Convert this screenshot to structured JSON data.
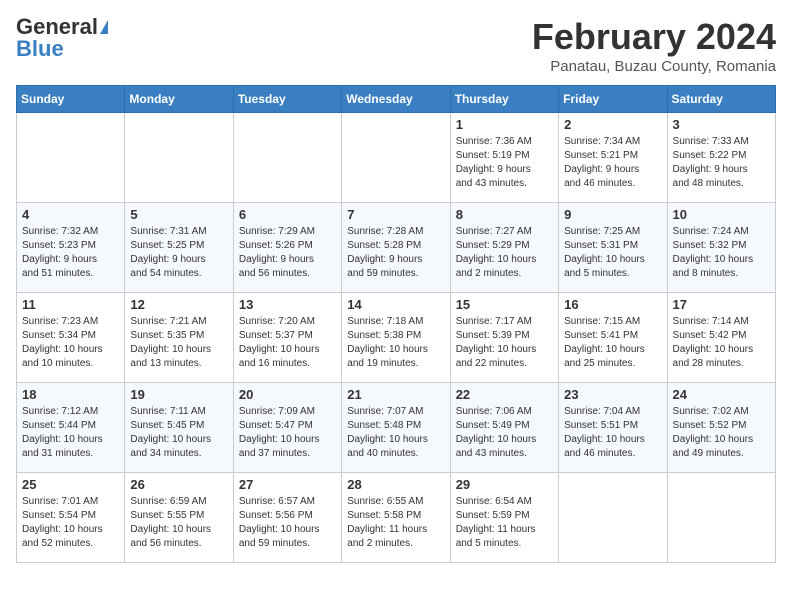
{
  "header": {
    "logo_general": "General",
    "logo_blue": "Blue",
    "month_title": "February 2024",
    "location": "Panatau, Buzau County, Romania"
  },
  "calendar": {
    "days_of_week": [
      "Sunday",
      "Monday",
      "Tuesday",
      "Wednesday",
      "Thursday",
      "Friday",
      "Saturday"
    ],
    "weeks": [
      [
        {
          "day": "",
          "info": ""
        },
        {
          "day": "",
          "info": ""
        },
        {
          "day": "",
          "info": ""
        },
        {
          "day": "",
          "info": ""
        },
        {
          "day": "1",
          "info": "Sunrise: 7:36 AM\nSunset: 5:19 PM\nDaylight: 9 hours\nand 43 minutes."
        },
        {
          "day": "2",
          "info": "Sunrise: 7:34 AM\nSunset: 5:21 PM\nDaylight: 9 hours\nand 46 minutes."
        },
        {
          "day": "3",
          "info": "Sunrise: 7:33 AM\nSunset: 5:22 PM\nDaylight: 9 hours\nand 48 minutes."
        }
      ],
      [
        {
          "day": "4",
          "info": "Sunrise: 7:32 AM\nSunset: 5:23 PM\nDaylight: 9 hours\nand 51 minutes."
        },
        {
          "day": "5",
          "info": "Sunrise: 7:31 AM\nSunset: 5:25 PM\nDaylight: 9 hours\nand 54 minutes."
        },
        {
          "day": "6",
          "info": "Sunrise: 7:29 AM\nSunset: 5:26 PM\nDaylight: 9 hours\nand 56 minutes."
        },
        {
          "day": "7",
          "info": "Sunrise: 7:28 AM\nSunset: 5:28 PM\nDaylight: 9 hours\nand 59 minutes."
        },
        {
          "day": "8",
          "info": "Sunrise: 7:27 AM\nSunset: 5:29 PM\nDaylight: 10 hours\nand 2 minutes."
        },
        {
          "day": "9",
          "info": "Sunrise: 7:25 AM\nSunset: 5:31 PM\nDaylight: 10 hours\nand 5 minutes."
        },
        {
          "day": "10",
          "info": "Sunrise: 7:24 AM\nSunset: 5:32 PM\nDaylight: 10 hours\nand 8 minutes."
        }
      ],
      [
        {
          "day": "11",
          "info": "Sunrise: 7:23 AM\nSunset: 5:34 PM\nDaylight: 10 hours\nand 10 minutes."
        },
        {
          "day": "12",
          "info": "Sunrise: 7:21 AM\nSunset: 5:35 PM\nDaylight: 10 hours\nand 13 minutes."
        },
        {
          "day": "13",
          "info": "Sunrise: 7:20 AM\nSunset: 5:37 PM\nDaylight: 10 hours\nand 16 minutes."
        },
        {
          "day": "14",
          "info": "Sunrise: 7:18 AM\nSunset: 5:38 PM\nDaylight: 10 hours\nand 19 minutes."
        },
        {
          "day": "15",
          "info": "Sunrise: 7:17 AM\nSunset: 5:39 PM\nDaylight: 10 hours\nand 22 minutes."
        },
        {
          "day": "16",
          "info": "Sunrise: 7:15 AM\nSunset: 5:41 PM\nDaylight: 10 hours\nand 25 minutes."
        },
        {
          "day": "17",
          "info": "Sunrise: 7:14 AM\nSunset: 5:42 PM\nDaylight: 10 hours\nand 28 minutes."
        }
      ],
      [
        {
          "day": "18",
          "info": "Sunrise: 7:12 AM\nSunset: 5:44 PM\nDaylight: 10 hours\nand 31 minutes."
        },
        {
          "day": "19",
          "info": "Sunrise: 7:11 AM\nSunset: 5:45 PM\nDaylight: 10 hours\nand 34 minutes."
        },
        {
          "day": "20",
          "info": "Sunrise: 7:09 AM\nSunset: 5:47 PM\nDaylight: 10 hours\nand 37 minutes."
        },
        {
          "day": "21",
          "info": "Sunrise: 7:07 AM\nSunset: 5:48 PM\nDaylight: 10 hours\nand 40 minutes."
        },
        {
          "day": "22",
          "info": "Sunrise: 7:06 AM\nSunset: 5:49 PM\nDaylight: 10 hours\nand 43 minutes."
        },
        {
          "day": "23",
          "info": "Sunrise: 7:04 AM\nSunset: 5:51 PM\nDaylight: 10 hours\nand 46 minutes."
        },
        {
          "day": "24",
          "info": "Sunrise: 7:02 AM\nSunset: 5:52 PM\nDaylight: 10 hours\nand 49 minutes."
        }
      ],
      [
        {
          "day": "25",
          "info": "Sunrise: 7:01 AM\nSunset: 5:54 PM\nDaylight: 10 hours\nand 52 minutes."
        },
        {
          "day": "26",
          "info": "Sunrise: 6:59 AM\nSunset: 5:55 PM\nDaylight: 10 hours\nand 56 minutes."
        },
        {
          "day": "27",
          "info": "Sunrise: 6:57 AM\nSunset: 5:56 PM\nDaylight: 10 hours\nand 59 minutes."
        },
        {
          "day": "28",
          "info": "Sunrise: 6:55 AM\nSunset: 5:58 PM\nDaylight: 11 hours\nand 2 minutes."
        },
        {
          "day": "29",
          "info": "Sunrise: 6:54 AM\nSunset: 5:59 PM\nDaylight: 11 hours\nand 5 minutes."
        },
        {
          "day": "",
          "info": ""
        },
        {
          "day": "",
          "info": ""
        }
      ]
    ]
  }
}
